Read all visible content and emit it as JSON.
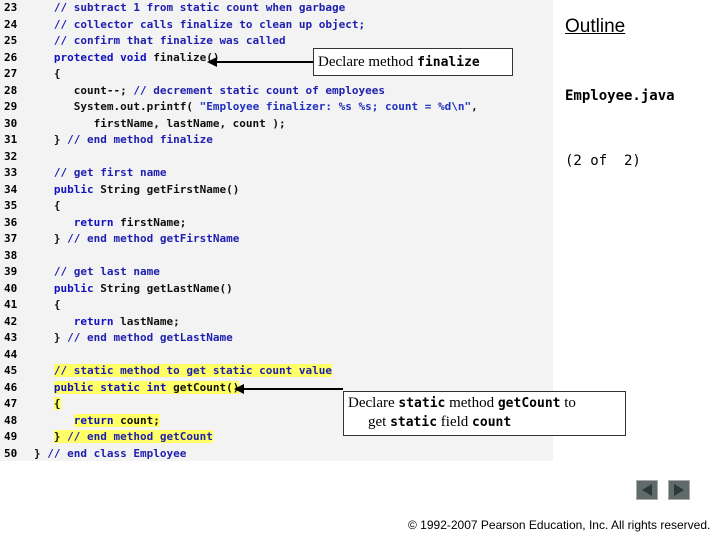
{
  "outline_title": "Outline",
  "file_name": "Employee.java",
  "page_info": "(2 of  2)",
  "callouts": {
    "finalize": {
      "prefix": "Declare method ",
      "code": "finalize"
    },
    "getcount": {
      "line1_prefix": "Declare ",
      "line1_code1": "static",
      "line1_mid": " method ",
      "line1_code2": "getCount",
      "line1_suffix": " to",
      "line2_prefix": "get ",
      "line2_code1": "static",
      "line2_mid": " field ",
      "line2_code2": "count"
    }
  },
  "code_lines": [
    {
      "n": "23",
      "text": "   // subtract 1 from static count when garbage"
    },
    {
      "n": "24",
      "text": "   // collector calls finalize to clean up object;"
    },
    {
      "n": "25",
      "text": "   // confirm that finalize was called"
    },
    {
      "n": "26",
      "text": "   protected void finalize()"
    },
    {
      "n": "27",
      "text": "   {"
    },
    {
      "n": "28",
      "text": "      count--; // decrement static count of employees"
    },
    {
      "n": "29",
      "text": "      System.out.printf( \"Employee finalizer: %s %s; count = %d\\n\","
    },
    {
      "n": "30",
      "text": "         firstName, lastName, count );"
    },
    {
      "n": "31",
      "text": "   } // end method finalize"
    },
    {
      "n": "32",
      "text": ""
    },
    {
      "n": "33",
      "text": "   // get first name"
    },
    {
      "n": "34",
      "text": "   public String getFirstName()"
    },
    {
      "n": "35",
      "text": "   {"
    },
    {
      "n": "36",
      "text": "      return firstName;"
    },
    {
      "n": "37",
      "text": "   } // end method getFirstName"
    },
    {
      "n": "38",
      "text": ""
    },
    {
      "n": "39",
      "text": "   // get last name"
    },
    {
      "n": "40",
      "text": "   public String getLastName()"
    },
    {
      "n": "41",
      "text": "   {"
    },
    {
      "n": "42",
      "text": "      return lastName;"
    },
    {
      "n": "43",
      "text": "   } // end method getLastName"
    },
    {
      "n": "44",
      "text": ""
    },
    {
      "n": "45",
      "text": "   // static method to get static count value",
      "hl": true
    },
    {
      "n": "46",
      "text": "   public static int getCount()",
      "hl": true
    },
    {
      "n": "47",
      "text": "   {",
      "hl": true
    },
    {
      "n": "48",
      "text": "      return count;",
      "hl": true
    },
    {
      "n": "49",
      "text": "   } // end method getCount",
      "hl": true
    },
    {
      "n": "50",
      "text": "} // end class Employee"
    }
  ],
  "copyright": "© 1992-2007 Pearson Education, Inc.  All rights reserved.",
  "colors": {
    "highlight": "#ffff66",
    "code_bg": "#f3f3f3",
    "keyword": "#1010c0",
    "nav_button": "#5f6b6b"
  },
  "icons": {
    "prev": "triangle-left-icon",
    "next": "triangle-right-icon"
  }
}
